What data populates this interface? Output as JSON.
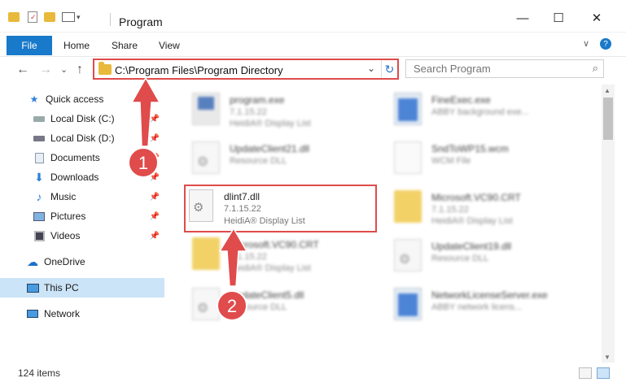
{
  "window": {
    "title": "Program",
    "minimize_glyph": "—",
    "maximize_glyph": "☐",
    "close_glyph": "✕"
  },
  "ribbon": {
    "file": "File",
    "tabs": [
      "Home",
      "Share",
      "View"
    ],
    "collapse_glyph": "∨",
    "help_glyph": "?"
  },
  "address": {
    "path": "C:\\Program Files\\Program Directory",
    "dropdown_glyph": "⌄",
    "refresh_glyph": "↻"
  },
  "search": {
    "placeholder": "Search Program",
    "icon_glyph": "⌕"
  },
  "nav": {
    "back_glyph": "←",
    "forward_glyph": "→",
    "recent_glyph": "⌄",
    "up_glyph": "↑",
    "items": [
      {
        "label": "Quick access",
        "icon": "star-icon",
        "pinned": false
      },
      {
        "label": "Local Disk (C:)",
        "icon": "drive-icon",
        "pinned": true
      },
      {
        "label": "Local Disk (D:)",
        "icon": "drive-icon",
        "pinned": true
      },
      {
        "label": "Documents",
        "icon": "documents-icon",
        "pinned": true
      },
      {
        "label": "Downloads",
        "icon": "downloads-icon",
        "pinned": true
      },
      {
        "label": "Music",
        "icon": "music-icon",
        "pinned": true
      },
      {
        "label": "Pictures",
        "icon": "pictures-icon",
        "pinned": true
      },
      {
        "label": "Videos",
        "icon": "videos-icon",
        "pinned": true
      },
      {
        "label": "OneDrive",
        "icon": "cloud-icon",
        "pinned": false
      },
      {
        "label": "This PC",
        "icon": "computer-icon",
        "pinned": false
      },
      {
        "label": "Network",
        "icon": "network-icon",
        "pinned": false
      }
    ]
  },
  "files": [
    {
      "name": "program.exe",
      "line2": "7.1.15.22",
      "line3": "HeidiA® Display List",
      "icon": "app-icon"
    },
    {
      "name": "FineExec.exe",
      "line2": "ABBY background exe...",
      "line3": "",
      "icon": "exe-icon"
    },
    {
      "name": "UpdateClient21.dll",
      "line2": "Resource DLL",
      "line3": "",
      "icon": "dll-icon"
    },
    {
      "name": "SndToWP15.wcm",
      "line2": "WCM File",
      "line3": "",
      "icon": "file-icon"
    },
    {
      "name": "dlint7.dll",
      "line2": "7.1.15.22",
      "line3": "HeidiA® Display List",
      "icon": "dll-icon"
    },
    {
      "name": "Microsoft.VC90.CRT",
      "line2": "7.1.15.22",
      "line3": "HeidiA® Display List",
      "icon": "folder-icon"
    },
    {
      "name": "Microsoft.VC90.CRT",
      "line2": "7.1.15.22",
      "line3": "HeidiA® Display List",
      "icon": "folder-icon"
    },
    {
      "name": "UpdateClient19.dll",
      "line2": "Resource DLL",
      "line3": "",
      "icon": "dll-icon"
    },
    {
      "name": "UpdateClient5.dll",
      "line2": "Resource DLL",
      "line3": "",
      "icon": "dll-icon"
    },
    {
      "name": "NetworkLicenseServer.exe",
      "line2": "ABBY network licens...",
      "line3": "",
      "icon": "exe-icon"
    }
  ],
  "status": {
    "count": "124 items"
  },
  "annotations": {
    "step1": "1",
    "step2": "2",
    "marker_color": "#e04b4b"
  }
}
